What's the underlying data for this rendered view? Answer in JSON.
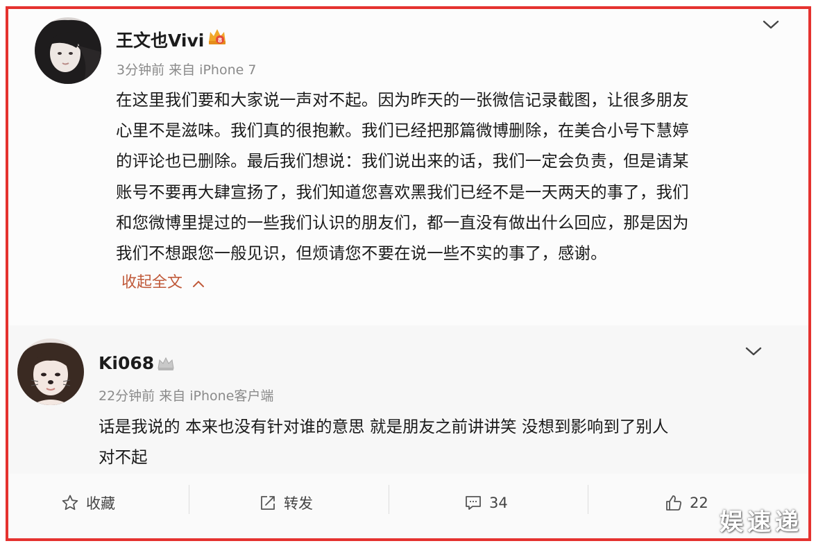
{
  "post": {
    "username": "王文也Vivi",
    "meta": "3分钟前 来自 iPhone 7",
    "lines": [
      "在这里我们要和大家说一声对不起。因为昨天的一张微信记录截图，让很多朋友",
      "心里不是滋味。我们真的很抱歉。我们已经把那篇微博删除，在美合小号下慧婷",
      "的评论也已删除。最后我们想说：我们说出来的话，我们一定会负责，但是请某",
      "账号不要再大肆宣扬了，我们知道您喜欢黑我们已经不是一天两天的事了，我们",
      "和您微博里提过的一些我们认识的朋友们，都一直没有做出什么回应，那是因为",
      "我们不想跟您一般见识，但烦请您不要在说一些不实的事了，感谢。"
    ],
    "collapse_label": "收起全文"
  },
  "comment": {
    "username": "Ki068",
    "meta": "22分钟前 来自 iPhone客户端",
    "lines": [
      "话是我说的 本来也没有针对谁的意思 就是朋友之前讲讲笑 没想到影响到了别人",
      "对不起"
    ]
  },
  "actions": {
    "favorite_label": "收藏",
    "repost_label": "转发",
    "comment_count": "34",
    "like_count": "22"
  },
  "watermark": "娱速递",
  "colors": {
    "frame_border": "#e5322f",
    "collapse_text": "#c05a3a",
    "badge_gold": "#f0a72a"
  }
}
